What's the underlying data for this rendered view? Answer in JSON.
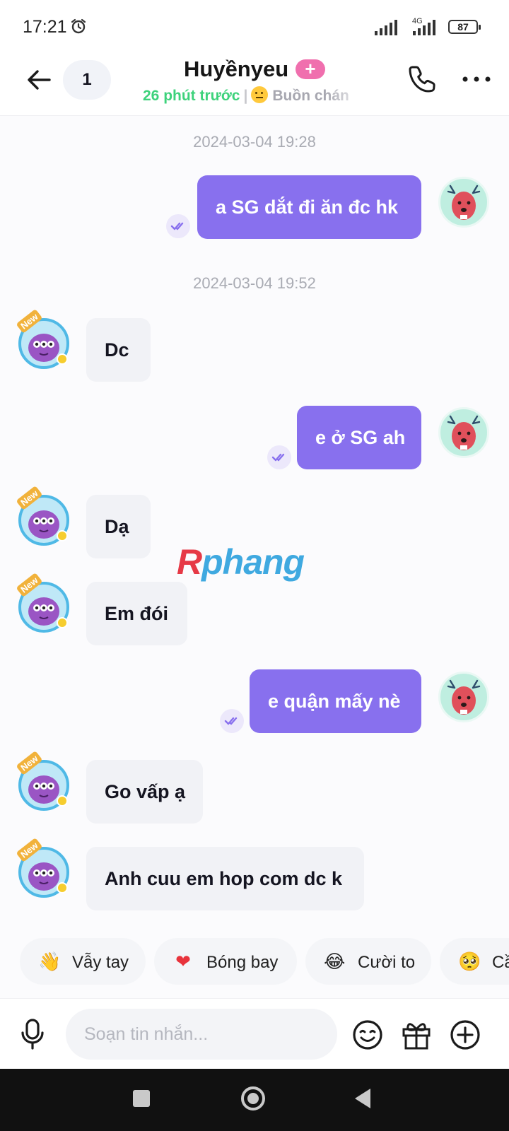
{
  "status_bar": {
    "time": "17:21",
    "network": "4G",
    "battery": "87"
  },
  "header": {
    "unread_count": "1",
    "contact_name": "Huyềnyeu",
    "plus_badge": "+",
    "last_seen": "26 phút trước",
    "separator": "|",
    "mood": "Buồn chán"
  },
  "messages": [
    {
      "type": "timestamp",
      "text": "2024-03-04 19:28"
    },
    {
      "type": "outgoing",
      "text": "a SG dắt đi ăn đc hk"
    },
    {
      "type": "timestamp",
      "text": "2024-03-04 19:52"
    },
    {
      "type": "incoming",
      "text": "Dc"
    },
    {
      "type": "outgoing",
      "text": "e ở SG ah"
    },
    {
      "type": "incoming",
      "text": "Dạ"
    },
    {
      "type": "incoming",
      "text": "Em đói"
    },
    {
      "type": "outgoing",
      "text": "e quận mấy nè"
    },
    {
      "type": "incoming",
      "text": "Go vấp ạ"
    },
    {
      "type": "incoming",
      "text": "Anh cuu em hop com dc k"
    }
  ],
  "avatar_tag": "New",
  "watermark": {
    "first": "R",
    "rest": "phang"
  },
  "quick_reactions": [
    {
      "icon": "👋",
      "label": "Vẫy tay"
    },
    {
      "icon": "❤",
      "label": "Bóng bay"
    },
    {
      "icon": "😂",
      "label": "Cười to"
    },
    {
      "icon": "🥺",
      "label": "Cầ"
    }
  ],
  "composer": {
    "placeholder": "Soạn tin nhắn..."
  },
  "colors": {
    "outgoing_bubble": "#8870ee",
    "incoming_bubble": "#f1f2f6",
    "online_green": "#3dd27b",
    "plus_pink": "#f06fae"
  }
}
